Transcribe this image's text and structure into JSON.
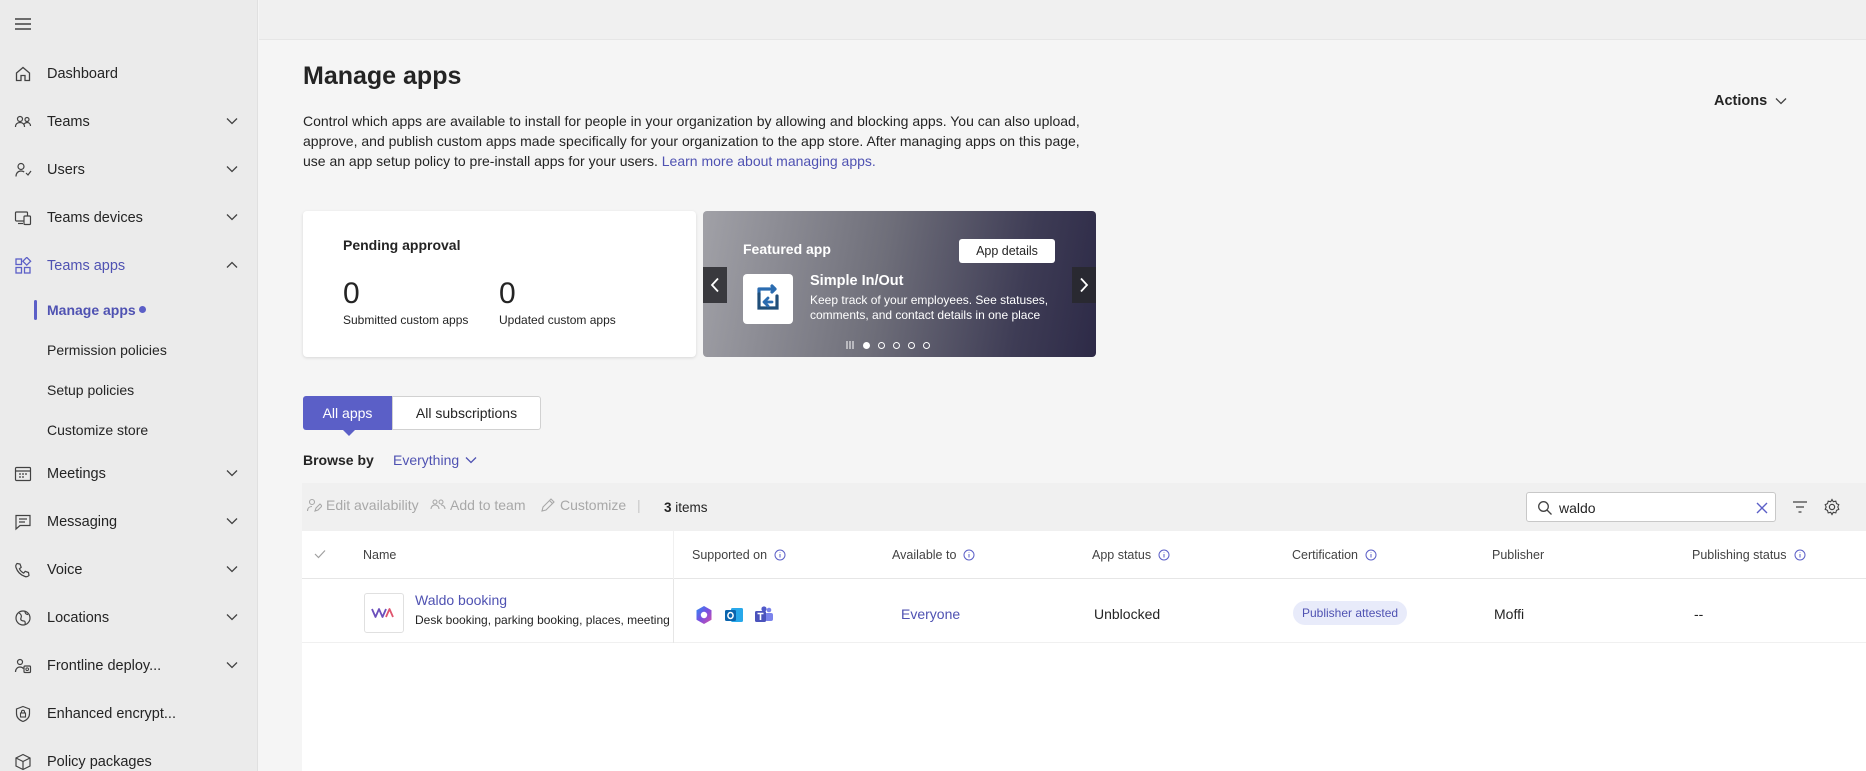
{
  "sidebar": {
    "menu_icon": "hamburger-icon",
    "items": [
      {
        "label": "Dashboard",
        "icon": "home-icon"
      },
      {
        "label": "Teams",
        "icon": "teams-icon"
      },
      {
        "label": "Users",
        "icon": "users-icon"
      },
      {
        "label": "Teams devices",
        "icon": "devices-icon"
      },
      {
        "label": "Teams apps",
        "icon": "apps-icon"
      },
      {
        "label": "Meetings",
        "icon": "calendar-icon"
      },
      {
        "label": "Messaging",
        "icon": "chat-icon"
      },
      {
        "label": "Voice",
        "icon": "phone-icon"
      },
      {
        "label": "Locations",
        "icon": "globe-icon"
      },
      {
        "label": "Frontline deploy...",
        "icon": "frontline-icon"
      },
      {
        "label": "Enhanced encrypt...",
        "icon": "shield-icon"
      },
      {
        "label": "Policy packages",
        "icon": "package-icon"
      }
    ],
    "subitems": [
      {
        "label": "Manage apps"
      },
      {
        "label": "Permission policies"
      },
      {
        "label": "Setup policies"
      },
      {
        "label": "Customize store"
      }
    ]
  },
  "page": {
    "title": "Manage apps",
    "actions_label": "Actions",
    "description": "Control which apps are available to install for people in your organization by allowing and blocking apps. You can also upload, approve, and publish custom apps made specifically for your organization to the app store. After managing apps on this page, use an app setup policy to pre-install apps for your users.",
    "learn_more": "Learn more about managing apps."
  },
  "pending": {
    "title": "Pending approval",
    "submitted_value": "0",
    "submitted_label": "Submitted custom apps",
    "updated_value": "0",
    "updated_label": "Updated custom apps"
  },
  "featured": {
    "title": "Featured app",
    "details_button": "App details",
    "app_name": "Simple In/Out",
    "app_desc": "Keep track of your employees. See statuses, comments, and contact details in one place",
    "pages": 5,
    "current_page": 1
  },
  "tabs": {
    "all_apps": "All apps",
    "all_subscriptions": "All subscriptions"
  },
  "browse": {
    "label": "Browse by",
    "value": "Everything"
  },
  "toolbar": {
    "edit_availability": "Edit availability",
    "add_to_team": "Add to team",
    "customize": "Customize",
    "count_value": "3",
    "count_label": "items",
    "search_value": "waldo"
  },
  "table": {
    "headers": {
      "name": "Name",
      "supported_on": "Supported on",
      "available_to": "Available to",
      "app_status": "App status",
      "certification": "Certification",
      "publisher": "Publisher",
      "publishing_status": "Publishing status"
    },
    "rows": [
      {
        "name": "Waldo booking",
        "description": "Desk booking, parking booking, places, meeting",
        "logo_text": "W",
        "platforms": [
          "copilot-icon",
          "outlook-icon",
          "teams-app-icon"
        ],
        "available_to": "Everyone",
        "app_status": "Unblocked",
        "certification": "Publisher attested",
        "publisher": "Moffi",
        "publishing_status": "--"
      }
    ]
  },
  "colors": {
    "accent": "#5b5fc7",
    "link": "#4f52b2",
    "sidebar_bg": "#ebebeb",
    "badge_bg": "#e8ebfa"
  }
}
